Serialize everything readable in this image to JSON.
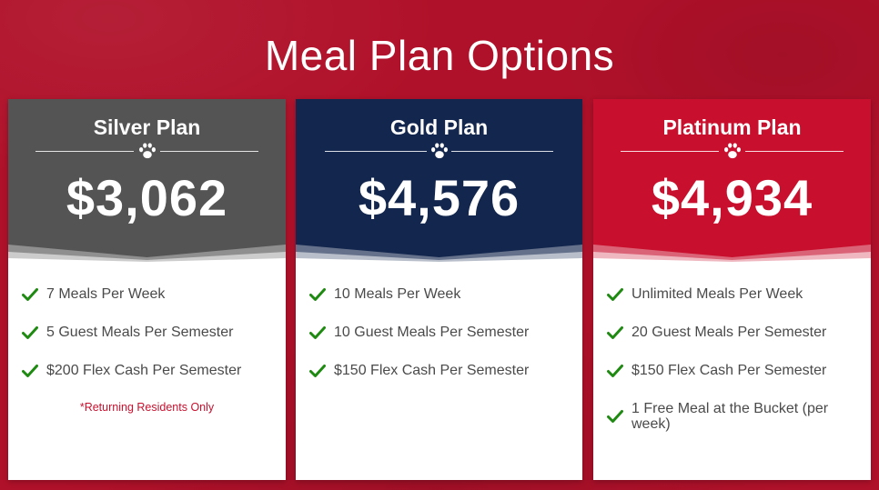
{
  "page": {
    "title": "Meal Plan Options"
  },
  "colors": {
    "background": "#b0112a",
    "silver": "#545454",
    "gold": "#13264d",
    "platinum": "#c8102e",
    "check": "#1f8a12",
    "note": "#c8102e"
  },
  "plans": [
    {
      "name": "Silver Plan",
      "price": "$3,062",
      "features": [
        "7 Meals Per Week",
        "5 Guest Meals Per Semester",
        "$200 Flex Cash Per Semester"
      ],
      "note": "*Returning Residents Only"
    },
    {
      "name": "Gold Plan",
      "price": "$4,576",
      "features": [
        "10 Meals Per Week",
        "10 Guest Meals Per Semester",
        "$150 Flex Cash Per Semester"
      ]
    },
    {
      "name": "Platinum Plan",
      "price": "$4,934",
      "features": [
        "Unlimited Meals Per Week",
        "20 Guest Meals Per Semester",
        "$150 Flex Cash Per Semester",
        "1 Free Meal at the Bucket (per week)"
      ]
    }
  ],
  "icons": {
    "divider": "paw-icon",
    "feature": "check-icon"
  }
}
